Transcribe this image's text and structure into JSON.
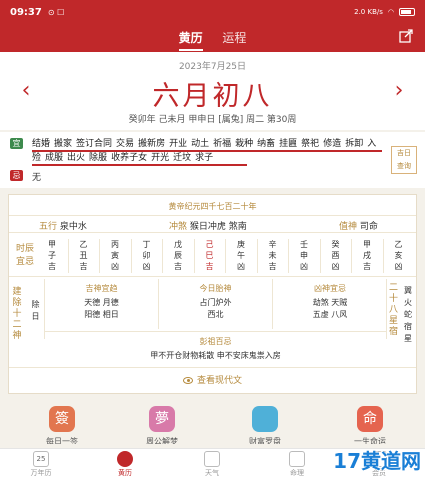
{
  "status": {
    "time": "09:37",
    "signal": "⊙ ☐",
    "net": "2.0 KB/s",
    "battery": ""
  },
  "header": {
    "tabs": [
      "黄历",
      "运程"
    ],
    "active_tab": 0
  },
  "date": {
    "gregorian": "2023年7月25日",
    "lunar": "六月初八",
    "ganzhi": "癸卯年 己未月 甲申日 [属兔] 周二 第30周"
  },
  "yi": {
    "label": "宜",
    "items": [
      "结婚",
      "搬家",
      "签订合同",
      "交易",
      "搬新房",
      "开业",
      "动土",
      "祈福",
      "栽种",
      "纳畜",
      "挂匾",
      "祭祀",
      "修造",
      "拆卸",
      "入殓",
      "成服",
      "出火",
      "除服",
      "收养子女",
      "开光",
      "迁坟",
      "求子"
    ]
  },
  "ji": {
    "label": "忌",
    "items": [
      "无"
    ]
  },
  "consult": {
    "line1": "吉日",
    "line2": "查询"
  },
  "table": {
    "era": "黄帝纪元四千七百二十年",
    "wuxing": {
      "label": "五行",
      "value": "泉中水"
    },
    "chongsha": {
      "label": "冲煞",
      "value": "猴日冲虎 煞南"
    },
    "zhishen": {
      "label": "值神",
      "value": "司命"
    },
    "hours_label": [
      "时辰",
      "宜忌"
    ],
    "hours": [
      {
        "gz": "甲",
        "zhi": "子",
        "luck": "吉"
      },
      {
        "gz": "乙",
        "zhi": "丑",
        "luck": "吉"
      },
      {
        "gz": "丙",
        "zhi": "寅",
        "luck": "凶"
      },
      {
        "gz": "丁",
        "zhi": "卯",
        "luck": "凶"
      },
      {
        "gz": "戊",
        "zhi": "辰",
        "luck": "吉"
      },
      {
        "gz": "己",
        "zhi": "巳",
        "luck": "吉"
      },
      {
        "gz": "庚",
        "zhi": "午",
        "luck": "凶"
      },
      {
        "gz": "辛",
        "zhi": "未",
        "luck": "吉"
      },
      {
        "gz": "壬",
        "zhi": "申",
        "luck": "凶"
      },
      {
        "gz": "癸",
        "zhi": "酉",
        "luck": "凶"
      },
      {
        "gz": "甲",
        "zhi": "戌",
        "luck": "吉"
      },
      {
        "gz": "乙",
        "zhi": "亥",
        "luck": "凶"
      }
    ],
    "current_hour_index": 5,
    "jianchu_label": "建除十二神",
    "jianchu_value": "除日",
    "jishen": {
      "label": "吉神宜趋",
      "lines": [
        "天德 月德",
        "阳德 相日"
      ]
    },
    "taishen": {
      "label": "今日胎神",
      "lines": [
        "占门炉外",
        "西北"
      ]
    },
    "xiongshen": {
      "label": "凶神宜忌",
      "lines": [
        "劫煞 天贼",
        "五虚 八风"
      ]
    },
    "xiu_label": "二十八星宿",
    "xiu_value": "翼火蛇宿星",
    "pengzu": {
      "label": "彭祖百忌",
      "value": "甲不开仓财物耗散 申不安床鬼祟入房"
    },
    "modern": "查看现代文"
  },
  "shortcuts": [
    {
      "icon": "簽",
      "label": "每日一签",
      "color": "#e2764f"
    },
    {
      "icon": "夢",
      "label": "周公解梦",
      "color": "#d87aa9"
    },
    {
      "icon": "",
      "label": "财富罗盘",
      "color": "#4fb0d8"
    },
    {
      "icon": "命",
      "label": "一生命运",
      "color": "#e5644f"
    }
  ],
  "nav": [
    {
      "icon": "25",
      "label": "万年历"
    },
    {
      "icon": "",
      "label": "黄历"
    },
    {
      "icon": "",
      "label": "天气"
    },
    {
      "icon": "",
      "label": "命理"
    },
    {
      "icon": "",
      "label": "会员"
    }
  ],
  "watermark": "17黄道网"
}
